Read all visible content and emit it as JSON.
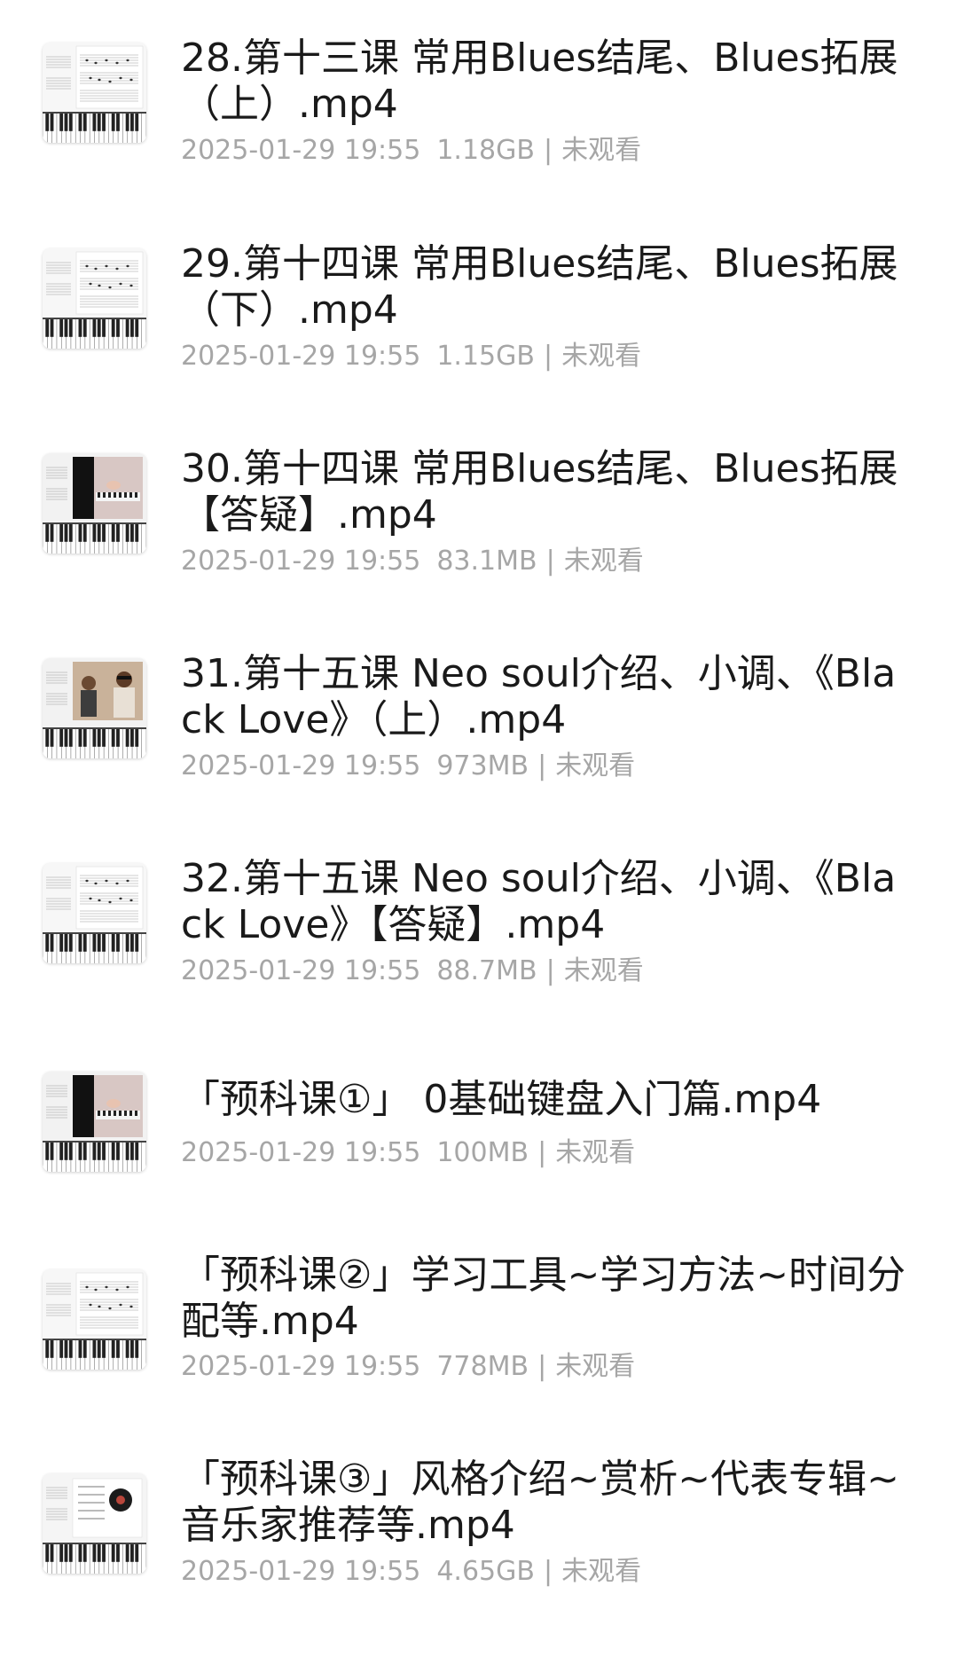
{
  "files": [
    {
      "title": "28.第十三课 常用Blues结尾、Blues拓展（上）.mp4",
      "date": "2025-01-29 19:55",
      "size": "1.18GB",
      "separator": "|",
      "status": "未观看",
      "thumb": "piano-sheet",
      "icon": "video-thumbnail"
    },
    {
      "title": "29.第十四课 常用Blues结尾、Blues拓展（下）.mp4",
      "date": "2025-01-29 19:55",
      "size": "1.15GB",
      "separator": "|",
      "status": "未观看",
      "thumb": "piano-sheet",
      "icon": "video-thumbnail"
    },
    {
      "title": "30.第十四课 常用Blues结尾、Blues拓展【答疑】.mp4",
      "date": "2025-01-29 19:55",
      "size": "83.1MB",
      "separator": "|",
      "status": "未观看",
      "thumb": "piano-player",
      "icon": "video-thumbnail"
    },
    {
      "title": "31.第十五课 Neo soul介绍、小调、《Black Love》（上）.mp4",
      "date": "2025-01-29 19:55",
      "size": "973MB",
      "separator": "|",
      "status": "未观看",
      "thumb": "people",
      "icon": "video-thumbnail"
    },
    {
      "title": "32.第十五课 Neo soul介绍、小调、《Black Love》【答疑】.mp4",
      "date": "2025-01-29 19:55",
      "size": "88.7MB",
      "separator": "|",
      "status": "未观看",
      "thumb": "piano-sheet",
      "icon": "video-thumbnail"
    },
    {
      "title": "「预科课①」 0基础键盘入门篇.mp4",
      "date": "2025-01-29 19:55",
      "size": "100MB",
      "separator": "|",
      "status": "未观看",
      "thumb": "piano-player",
      "icon": "video-thumbnail"
    },
    {
      "title": "「预科课②」学习工具~学习方法~时间分配等.mp4",
      "date": "2025-01-29 19:55",
      "size": "778MB",
      "separator": "|",
      "status": "未观看",
      "thumb": "piano-sheet",
      "icon": "video-thumbnail"
    },
    {
      "title": "「预科课③」风格介绍~赏析~代表专辑~音乐家推荐等.mp4",
      "date": "2025-01-29 19:55",
      "size": "4.65GB",
      "separator": "|",
      "status": "未观看",
      "thumb": "record",
      "icon": "video-thumbnail"
    }
  ],
  "colors": {
    "title": "#1a1a1a",
    "meta": "#a6a6a6",
    "background": "#ffffff"
  }
}
